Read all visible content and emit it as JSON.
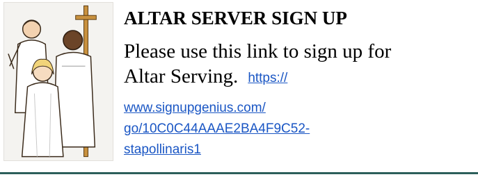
{
  "title": "ALTAR SERVER SIGN UP",
  "body": {
    "line1": "Please use this link to sign up for",
    "line2": "Altar Serving."
  },
  "link": {
    "part1": "https://",
    "part2": "www.signupgenius.com/",
    "part3": "go/10C0C44AAAE2BA4F9C52-",
    "part4": "stapollinaris1"
  },
  "illustration": {
    "icon": "altar-servers-illustration-icon"
  },
  "colors": {
    "link": "#1a56c4",
    "rule": "#2c5f5a"
  }
}
